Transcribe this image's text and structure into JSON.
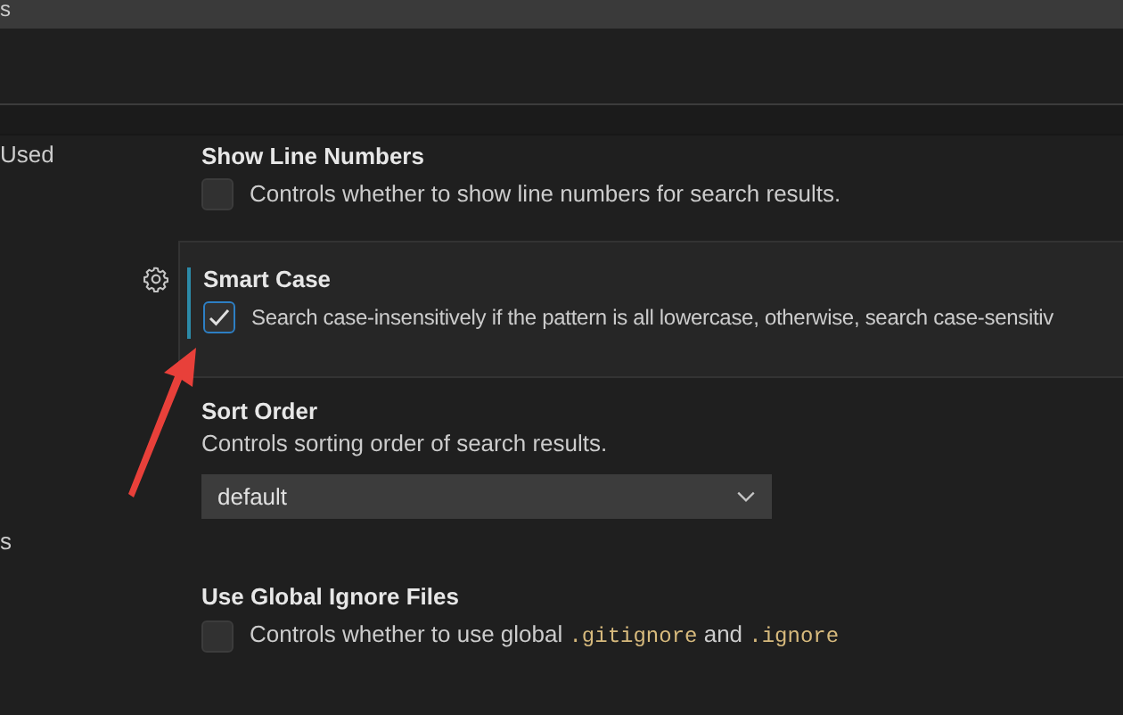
{
  "title_bar": {
    "title": "s"
  },
  "sidebar": {
    "items": [
      {
        "label": "Used"
      },
      {
        "label": "s"
      }
    ]
  },
  "settings": [
    {
      "kind": "checkbox",
      "title": "Show Line Numbers",
      "description": [
        {
          "kind": "text",
          "text": "Controls whether to show line numbers for search results."
        }
      ],
      "checked": false,
      "focused": false
    },
    {
      "kind": "checkbox",
      "title": "Smart Case",
      "description": [
        {
          "kind": "text",
          "text": "Search case-insensitively if the pattern is all lowercase, otherwise, search case-sensitiv"
        }
      ],
      "checked": true,
      "focused": true
    },
    {
      "kind": "dropdown",
      "title": "Sort Order",
      "description": [
        {
          "kind": "text",
          "text": "Controls sorting order of search results."
        }
      ],
      "value": "default",
      "focused": false
    },
    {
      "kind": "checkbox",
      "title": "Use Global Ignore Files",
      "description": [
        {
          "kind": "text",
          "text": "Controls whether to use global "
        },
        {
          "kind": "code",
          "text": ".gitignore"
        },
        {
          "kind": "text",
          "text": " and "
        },
        {
          "kind": "code",
          "text": ".ignore"
        }
      ],
      "checked": false,
      "focused": false
    }
  ]
}
